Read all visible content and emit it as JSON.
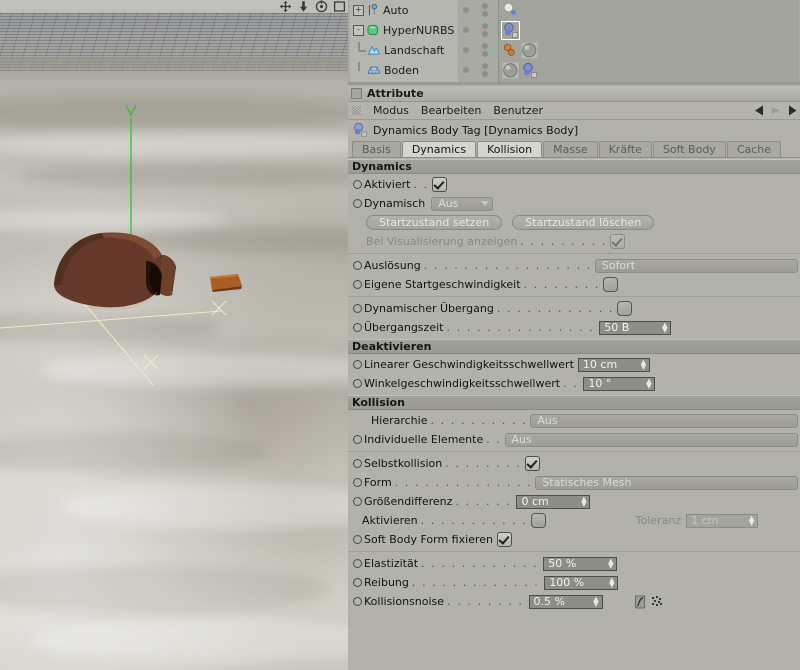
{
  "viewport": {
    "nav_icons": [
      {
        "name": "move-camera-icon",
        "glyph": "move"
      },
      {
        "name": "zoom-camera-icon",
        "glyph": "down-arrow"
      },
      {
        "name": "rotate-camera-icon",
        "glyph": "rotate"
      },
      {
        "name": "maximize-viewport-icon",
        "glyph": "square"
      }
    ],
    "axis_label": "Y"
  },
  "object_manager": {
    "rows": [
      {
        "label": "Auto",
        "icon": "auto-keyframe-icon",
        "expander": "+",
        "depth": 0,
        "check": false
      },
      {
        "label": "HyperNURBS",
        "icon": "hypernurbs-icon",
        "expander": "-",
        "depth": 0,
        "check": true
      },
      {
        "label": "Landschaft",
        "icon": "landscape-icon",
        "expander": "",
        "depth": 1,
        "check": true
      },
      {
        "label": "Boden",
        "icon": "floor-icon",
        "expander": "",
        "depth": 0,
        "check": false
      }
    ],
    "tags": [
      [
        "dynamics-body-tag-white"
      ],
      [
        "dynamics-body-tag-blue-selected"
      ],
      [
        "material-tag-orange",
        "material-tag-gray"
      ],
      [
        "material-tag-gray",
        "dynamics-body-tag-blue"
      ]
    ]
  },
  "attribute_manager": {
    "panel_title": "Attribute",
    "menu": [
      "Modus",
      "Bearbeiten",
      "Benutzer"
    ],
    "nav": [
      "back-arrow-icon",
      "forward-arrow-icon",
      "up-arrow-icon"
    ],
    "object_title": "Dynamics Body Tag [Dynamics Body]",
    "object_icon": "dynamics-body-tag-icon",
    "tabs": [
      {
        "label": "Basis",
        "active": false
      },
      {
        "label": "Dynamics",
        "active": true
      },
      {
        "label": "Kollision",
        "active": true
      },
      {
        "label": "Masse",
        "active": false
      },
      {
        "label": "Kräfte",
        "active": false
      },
      {
        "label": "Soft Body",
        "active": false
      },
      {
        "label": "Cache",
        "active": false
      }
    ],
    "sections": {
      "dynamics": {
        "header": "Dynamics",
        "aktiviert_label": "Aktiviert",
        "aktiviert_dots": ". .",
        "aktiviert_checked": true,
        "dynamisch_label": "Dynamisch",
        "dynamisch_value": "Aus",
        "btn_set": "Startzustand setzen",
        "btn_clear": "Startzustand löschen",
        "visualisierung_label": "Bei Visualisierung anzeigen",
        "visualisierung_dots": ". . . . . . . . .",
        "visualisierung_checked": true,
        "ausloesung_label": "Auslösung",
        "ausloesung_dots": ". . . . . . . . . . . . . . . . .",
        "ausloesung_value": "Sofort",
        "startgeschw_label": "Eigene Startgeschwindigkeit",
        "startgeschw_dots": ". . . . . . . .",
        "uebergang_label": "Dynamischer Übergang",
        "uebergang_dots": ". . . . . . . . . . . .",
        "uebergangszeit_label": "Übergangszeit",
        "uebergangszeit_dots": ". . . . . . . . . . . . . . .",
        "uebergangszeit_value": "50 B"
      },
      "deaktivieren": {
        "header": "Deaktivieren",
        "linear_label": "Linearer Geschwindigkeitsschwellwert",
        "linear_value": "10 cm",
        "winkel_label": "Winkelgeschwindigkeitsschwellwert",
        "winkel_dots": ". .",
        "winkel_value": "10 °"
      },
      "kollision": {
        "header": "Kollision",
        "hierarchie_label": "Hierarchie",
        "hierarchie_dots": ". . . . . . . . . .",
        "hierarchie_value": "Aus",
        "individuelle_label": "Individuelle Elemente",
        "individuelle_dots": ". .",
        "individuelle_value": "Aus",
        "selbstkollision_label": "Selbstkollision",
        "selbstkollision_dots": ". . . . . . . .",
        "selbstkollision_checked": true,
        "form_label": "Form",
        "form_dots": ". . . . . . . . . . . . . .",
        "form_value": "Statisches Mesh",
        "groessendifferenz_label": "Größendifferenz",
        "groessendifferenz_dots": ". . . . . .",
        "groessendifferenz_value": "0 cm",
        "aktivieren_label": "Aktivieren",
        "aktivieren_dots": ". . . . . . . . . . .",
        "toleranz_label": "Toleranz",
        "toleranz_value": "1 cm",
        "softbody_label": "Soft Body Form fixieren",
        "softbody_checked": true,
        "elastizitaet_label": "Elastizität",
        "elastizitaet_dots": ". . . . . . . . . . . .",
        "elastizitaet_value": "50 %",
        "reibung_label": "Reibung",
        "reibung_dots": ". . . . . . . . . . . . .",
        "reibung_value": "100 %",
        "kollisionsnoise_label": "Kollisionsnoise",
        "kollisionsnoise_dots": ". . . . . . . .",
        "kollisionsnoise_value": "0.5 %",
        "extra_icons": [
          "spline-curve-icon",
          "noise-icon"
        ]
      }
    }
  },
  "colors": {
    "panel_bg": "#b2b2aa",
    "section_bar": "#9e9e97",
    "field_bg": "#8e8e88",
    "field_text": "#f2f2ee",
    "tab_active": "#d5d5cf",
    "check_green": "#6ecb8c",
    "axis_green": "#3fbf3f",
    "handle_yellow": "#efeec8"
  }
}
